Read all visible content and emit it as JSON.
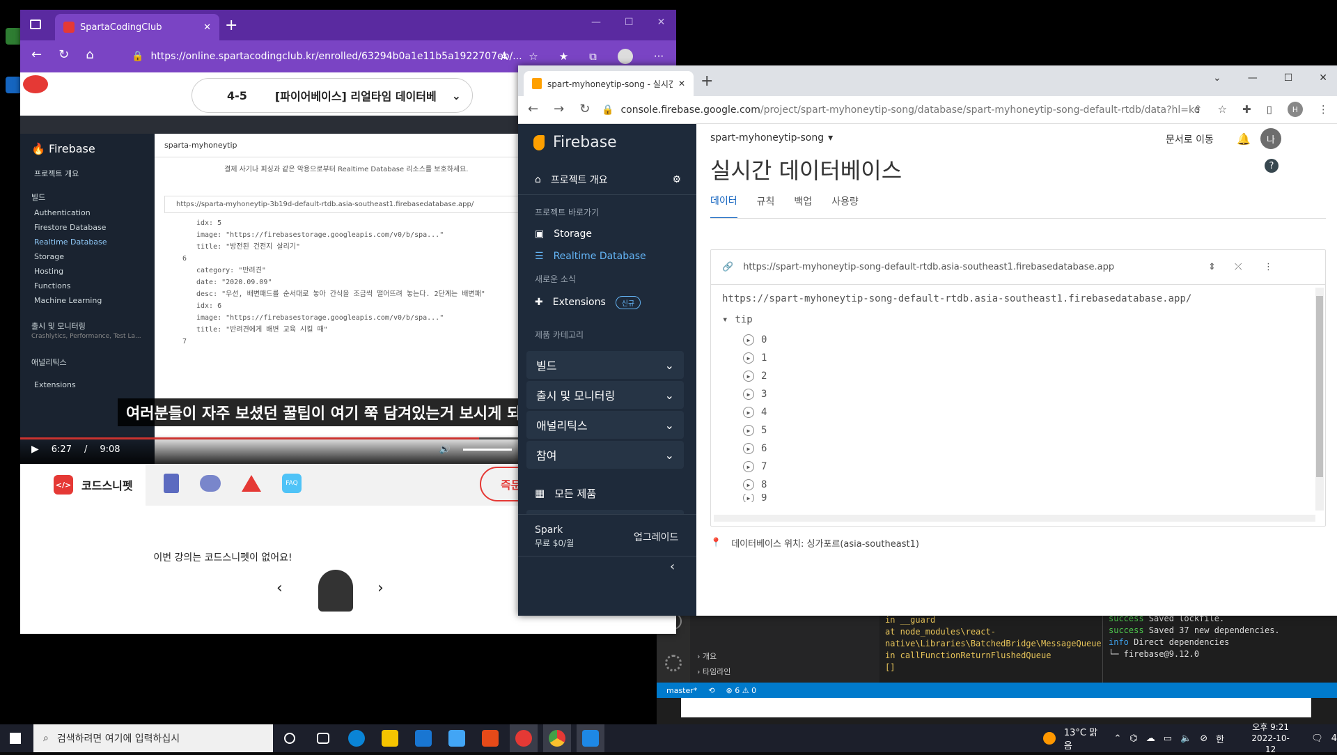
{
  "edge": {
    "tab_title": "SpartaCodingClub",
    "url": "https://online.spartacodingclub.kr/enrolled/63294b0a1e11b5a1922707eb/...",
    "lecture_number": "4-5",
    "lecture_title": "[파이어베이스] 리얼타임 데이터베",
    "video": {
      "fb_url": "https://sparta-myhoneytip-3b19d-default-rtdb.asia-southeast1.firebasedatabase.app/",
      "project": "sparta-myhoneytip",
      "notice": "결제 사기나 피싱과 같은 악용으로부터 Realtime Database 리소스를 보호하세요.",
      "side_items": [
        "프로젝트 개요",
        "빌드",
        "Authentication",
        "Firestore Database",
        "Realtime Database",
        "Storage",
        "Hosting",
        "Functions",
        "Machine Learning",
        "출시 및 모니터링",
        "Crashlytics, Performance, Test La...",
        "애널리틱스",
        "Extensions"
      ],
      "code_lines": [
        "idx: 5",
        "image: \"https://firebasestorage.googleapis.com/v0/b/spa...\"",
        "title: \"방전된 건전지 살리기\"",
        "6",
        "category: \"반려견\"",
        "date: \"2020.09.09\"",
        "desc: \"우선, 배변패드를 순서대로 놓아 간식을 조금씩 떨어뜨려 놓는다. 2단계는 배변패\"",
        "idx: 6",
        "image: \"https://firebasestorage.googleapis.com/v0/b/spa...\"",
        "title: \"반려견에게 배변 교육 시킬 때\"",
        "7"
      ],
      "subtitle": "여러분들이 자주 보셨던 꿀팁이 여기 쭉 담겨있는거 보시게 되",
      "time_current": "6:27",
      "time_sep": "/",
      "time_total": "9:08",
      "progress": 0.7
    },
    "snippet": {
      "title": "코드스니펫",
      "empty_msg": "이번 강의는 코드스니펫이 없어요!",
      "cta": "즉문",
      "faq": "FAQ"
    }
  },
  "chrome": {
    "tab_title": "spart-myhoneytip-song - 실시간",
    "url_host": "console.firebase.google.com",
    "url_path": "/project/spart-myhoneytip-song/database/spart-myhoneytip-song-default-rtdb/data?hl=ko",
    "profile_initial": "H",
    "sidebar": {
      "brand": "Firebase",
      "overview": "프로젝트 개요",
      "shortcuts_label": "프로젝트 바로가기",
      "storage": "Storage",
      "rtdb": "Realtime Database",
      "news_label": "새로운 소식",
      "extensions": "Extensions",
      "new_badge": "신규",
      "categories_label": "제품 카테고리",
      "groups": [
        "빌드",
        "출시 및 모니터링",
        "애널리틱스",
        "참여"
      ],
      "all_products": "모든 제품",
      "plan_name": "Spark",
      "plan_price": "무료 $0/월",
      "upgrade": "업그레이드"
    },
    "main": {
      "project": "spart-myhoneytip-song",
      "docs_link": "문서로 이동",
      "avatar": "나",
      "page_title": "실시간 데이터베이스",
      "tabs": [
        "데이터",
        "규칙",
        "백업",
        "사용량"
      ],
      "db_url": "https://spart-myhoneytip-song-default-rtdb.asia-southeast1.firebasedatabase.app",
      "db_root": "https://spart-myhoneytip-song-default-rtdb.asia-southeast1.firebasedatabase.app/",
      "node": "tip",
      "children": [
        "0",
        "1",
        "2",
        "3",
        "4",
        "5",
        "6",
        "7",
        "8",
        "9"
      ],
      "location": "데이터베이스 위치: 싱가포르(asia-southeast1)"
    }
  },
  "vscode": {
    "explorer": [
      "개요",
      "타임라인"
    ],
    "term_left": "at node_modules\\react-native\\Libraries\\BatchedBridge\\MessageQueue.js:null in __guard\nat node_modules\\react-native\\Libraries\\BatchedBridge\\MessageQueue.js:null in callFunctionReturnFlushedQueue\n[]",
    "term_right": [
      {
        "tag": "success",
        "text": " Saved lockfile."
      },
      {
        "tag": "success",
        "text": " Saved 37 new dependencies."
      },
      {
        "tag": "info",
        "text": " Direct dependencies"
      },
      {
        "tag": "",
        "text": "└─ firebase@9.12.0"
      }
    ],
    "branch": "master*",
    "problems": "⊗ 6 ⚠ 0"
  },
  "taskbar": {
    "search_placeholder": "검색하려면 여기에 입력하십시",
    "weather": "13°C 맑음",
    "ime": "한",
    "time": "오후 9:21",
    "date": "2022-10-12",
    "notif_count": "4"
  }
}
